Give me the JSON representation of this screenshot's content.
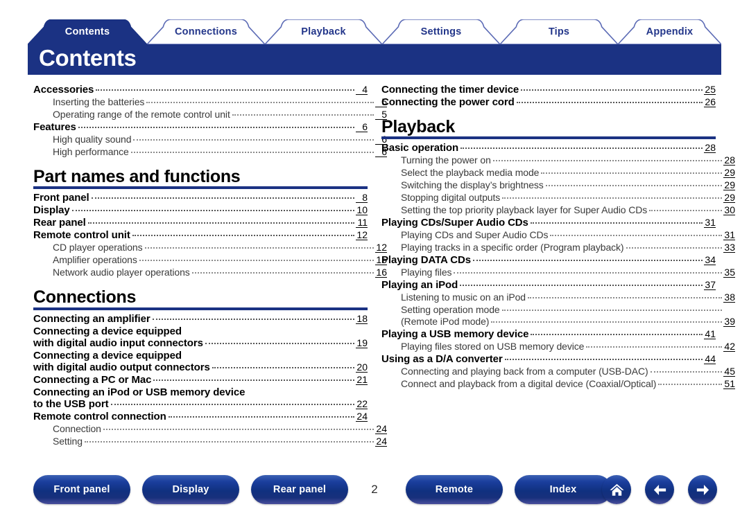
{
  "header": {
    "banner_title": "Contents",
    "accent_color": "#1b3283",
    "tab_text_color": "#23368a",
    "tabs": [
      {
        "label": "Contents",
        "active": true
      },
      {
        "label": "Connections",
        "active": false
      },
      {
        "label": "Playback",
        "active": false
      },
      {
        "label": "Settings",
        "active": false
      },
      {
        "label": "Tips",
        "active": false
      },
      {
        "label": "Appendix",
        "active": false
      }
    ]
  },
  "left_column": [
    {
      "type": "entry",
      "level": 1,
      "text": "Accessories",
      "page": "4"
    },
    {
      "type": "entry",
      "level": 2,
      "text": "Inserting the batteries",
      "page": "5"
    },
    {
      "type": "entry",
      "level": 2,
      "text": "Operating range of the remote control unit",
      "page": "5"
    },
    {
      "type": "entry",
      "level": 1,
      "text": "Features",
      "page": "6"
    },
    {
      "type": "entry",
      "level": 2,
      "text": "High quality sound",
      "page": "6"
    },
    {
      "type": "entry",
      "level": 2,
      "text": "High performance",
      "page": "6"
    },
    {
      "type": "section",
      "title": "Part names and functions"
    },
    {
      "type": "entry",
      "level": 1,
      "text": "Front panel",
      "page": "8"
    },
    {
      "type": "entry",
      "level": 1,
      "text": "Display",
      "page": "10"
    },
    {
      "type": "entry",
      "level": 1,
      "text": "Rear panel",
      "page": "11"
    },
    {
      "type": "entry",
      "level": 1,
      "text": "Remote control unit",
      "page": "12"
    },
    {
      "type": "entry",
      "level": 2,
      "text": "CD player operations",
      "page": "12"
    },
    {
      "type": "entry",
      "level": 2,
      "text": "Amplifier operations",
      "page": "15"
    },
    {
      "type": "entry",
      "level": 2,
      "text": "Network audio player operations",
      "page": "16"
    },
    {
      "type": "section",
      "title": "Connections"
    },
    {
      "type": "entry",
      "level": 1,
      "text": "Connecting an amplifier",
      "page": "18"
    },
    {
      "type": "cont",
      "level": 1,
      "text": "Connecting a device equipped"
    },
    {
      "type": "entry",
      "level": 1,
      "text": "with digital audio input connectors",
      "page": "19"
    },
    {
      "type": "cont",
      "level": 1,
      "text": "Connecting a device equipped"
    },
    {
      "type": "entry",
      "level": 1,
      "text": "with digital audio output connectors",
      "page": "20"
    },
    {
      "type": "entry",
      "level": 1,
      "text": "Connecting a PC or Mac",
      "page": "21"
    },
    {
      "type": "cont",
      "level": 1,
      "text": "Connecting an iPod or USB memory device"
    },
    {
      "type": "entry",
      "level": 1,
      "text": "to the USB port",
      "page": "22"
    },
    {
      "type": "entry",
      "level": 1,
      "text": "Remote control connection",
      "page": "24"
    },
    {
      "type": "entry",
      "level": 2,
      "text": "Connection",
      "page": "24"
    },
    {
      "type": "entry",
      "level": 2,
      "text": "Setting",
      "page": "24"
    }
  ],
  "right_column": [
    {
      "type": "entry",
      "level": 1,
      "text": "Connecting the timer device",
      "page": "25"
    },
    {
      "type": "entry",
      "level": 1,
      "text": "Connecting the power cord",
      "page": "26"
    },
    {
      "type": "section",
      "title": "Playback"
    },
    {
      "type": "entry",
      "level": 1,
      "text": "Basic operation",
      "page": "28"
    },
    {
      "type": "entry",
      "level": 2,
      "text": "Turning the power on",
      "page": "28"
    },
    {
      "type": "entry",
      "level": 2,
      "text": "Select the playback media mode",
      "page": "29"
    },
    {
      "type": "entry",
      "level": 2,
      "text": "Switching the display’s brightness",
      "page": "29"
    },
    {
      "type": "entry",
      "level": 2,
      "text": "Stopping digital outputs",
      "page": "29"
    },
    {
      "type": "entry",
      "level": 2,
      "text": "Setting the top priority playback layer for Super Audio CDs",
      "page": "30"
    },
    {
      "type": "entry",
      "level": 1,
      "text": "Playing CDs/Super Audio CDs",
      "page": "31"
    },
    {
      "type": "entry",
      "level": 2,
      "text": "Playing CDs and Super Audio CDs",
      "page": "31"
    },
    {
      "type": "entry",
      "level": 2,
      "text": "Playing tracks in a specific order (Program playback)",
      "page": "33"
    },
    {
      "type": "entry",
      "level": 1,
      "text": "Playing DATA CDs",
      "page": "34"
    },
    {
      "type": "entry",
      "level": 2,
      "text": "Playing files",
      "page": "35"
    },
    {
      "type": "entry",
      "level": 1,
      "text": "Playing an iPod",
      "page": "37"
    },
    {
      "type": "entry",
      "level": 2,
      "text": "Listening to music on an iPod",
      "page": "38"
    },
    {
      "type": "cont",
      "level": 2,
      "text": "Setting operation mode"
    },
    {
      "type": "entry",
      "level": 2,
      "text": "(Remote iPod mode)",
      "page": "39"
    },
    {
      "type": "entry",
      "level": 1,
      "text": "Playing a USB memory device",
      "page": "41"
    },
    {
      "type": "entry",
      "level": 2,
      "text": "Playing files stored on USB memory device",
      "page": "42"
    },
    {
      "type": "entry",
      "level": 1,
      "text": "Using as a D/A converter",
      "page": "44"
    },
    {
      "type": "entry",
      "level": 2,
      "text": "Connecting and playing back from a computer (USB-DAC)",
      "page": "45"
    },
    {
      "type": "entry",
      "level": 2,
      "text": "Connect and playback from a digital device (Coaxial/Optical)",
      "page": "51"
    }
  ],
  "footer": {
    "page_number": "2",
    "buttons": [
      {
        "label": "Front panel",
        "name": "front-panel-button"
      },
      {
        "label": "Display",
        "name": "display-button"
      },
      {
        "label": "Rear panel",
        "name": "rear-panel-button"
      },
      {
        "label": "Remote",
        "name": "remote-button"
      },
      {
        "label": "Index",
        "name": "index-button"
      }
    ],
    "icons": [
      {
        "name": "home-icon"
      },
      {
        "name": "arrow-left-icon"
      },
      {
        "name": "arrow-right-icon"
      }
    ]
  }
}
